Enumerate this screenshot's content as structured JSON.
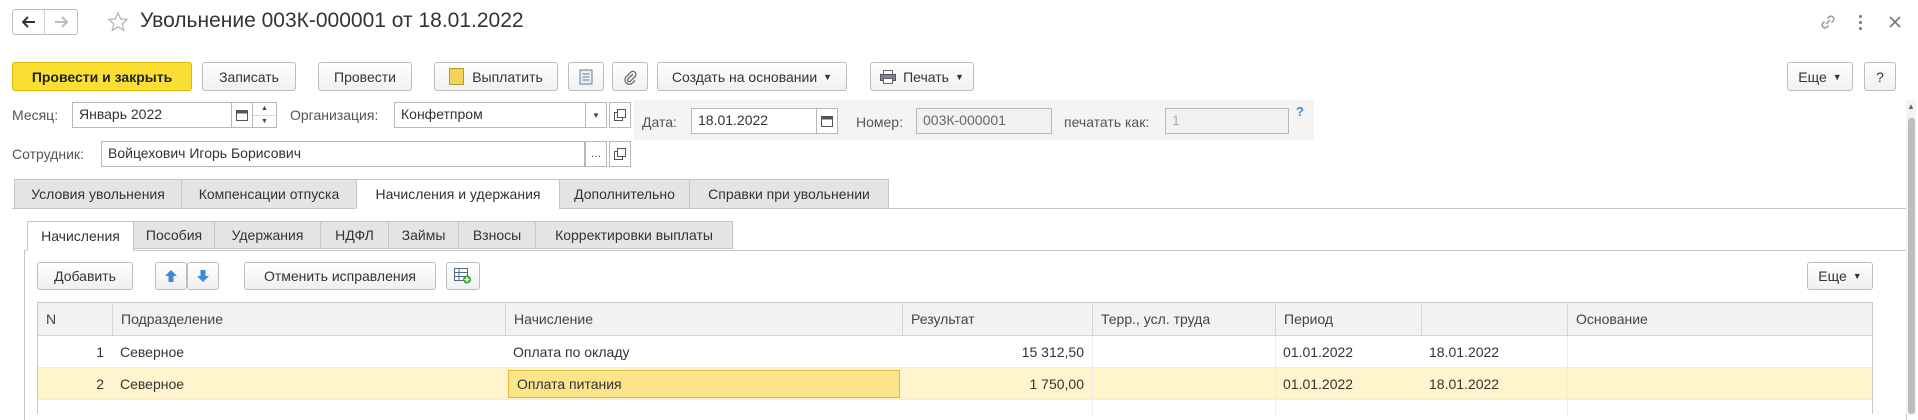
{
  "title": "Увольнение 003К-000001 от 18.01.2022",
  "toolbar": {
    "post_close": "Провести и закрыть",
    "save": "Записать",
    "post": "Провести",
    "pay": "Выплатить",
    "create_based": "Создать на основании",
    "print": "Печать",
    "more": "Еще",
    "help": "?"
  },
  "form": {
    "month_label": "Месяц:",
    "month_value": "Январь 2022",
    "org_label": "Организация:",
    "org_value": "Конфетпром",
    "date_label": "Дата:",
    "date_value": "18.01.2022",
    "number_label": "Номер:",
    "number_value": "003К-000001",
    "print_as_label": "печатать как:",
    "print_as_value": "1",
    "hint": "?",
    "employee_label": "Сотрудник:",
    "employee_value": "Войцехович Игорь Борисович"
  },
  "tabs": [
    "Условия увольнения",
    "Компенсации отпуска",
    "Начисления и удержания",
    "Дополнительно",
    "Справки при увольнении"
  ],
  "subtabs": [
    "Начисления",
    "Пособия",
    "Удержания",
    "НДФЛ",
    "Займы",
    "Взносы",
    "Корректировки выплаты"
  ],
  "table_toolbar": {
    "add": "Добавить",
    "cancel_corrections": "Отменить исправления",
    "more": "Еще"
  },
  "table": {
    "columns": [
      "N",
      "Подразделение",
      "Начисление",
      "Результат",
      "Терр., усл. труда",
      "Период",
      "",
      "Основание"
    ],
    "rows": [
      {
        "n": "1",
        "dept": "Северное",
        "accrual": "Оплата по окладу",
        "result": "15 312,50",
        "terr": "",
        "from": "01.01.2022",
        "to": "18.01.2022",
        "basis": ""
      },
      {
        "n": "2",
        "dept": "Северное",
        "accrual": "Оплата питания",
        "result": "1 750,00",
        "terr": "",
        "from": "01.01.2022",
        "to": "18.01.2022",
        "basis": ""
      }
    ]
  },
  "colors": {
    "accent": "#fbe033",
    "selected_row": "#fff5cc",
    "selected_cell": "#fce48a",
    "arrow_blue": "#3a8bd6"
  }
}
